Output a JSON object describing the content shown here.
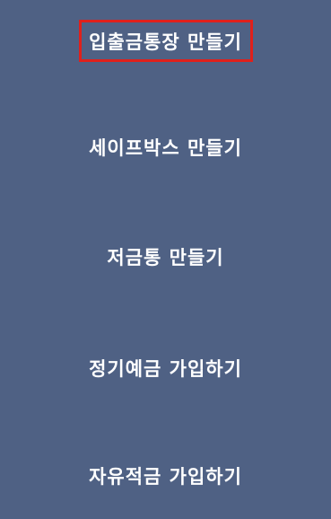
{
  "menu": {
    "items": [
      {
        "label": "입출금통장 만들기"
      },
      {
        "label": "세이프박스 만들기"
      },
      {
        "label": "저금통 만들기"
      },
      {
        "label": "정기예금 가입하기"
      },
      {
        "label": "자유적금 가입하기"
      }
    ]
  },
  "highlight": {
    "color": "#e0201b"
  },
  "background_color": "#4f6184"
}
